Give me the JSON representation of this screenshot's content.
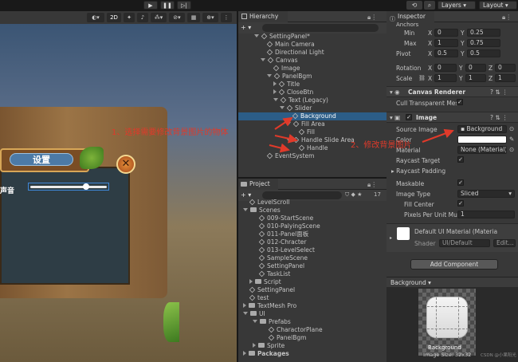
{
  "toolbar": {
    "play": "▶",
    "pause": "❚❚",
    "step": "▷|",
    "search": "⌕",
    "layers": "Layers",
    "layout": "Layout"
  },
  "scene": {
    "btn2d": "2D",
    "title_text": "设置",
    "sound_label": "声音",
    "close_symbol": "✕"
  },
  "hierarchy": {
    "tab": "Hierarchy",
    "add": "+ ▾",
    "items": [
      "SettingPanel*",
      "Main Camera",
      "Directional Light",
      "Canvas",
      "Image",
      "PanelBgm",
      "Title",
      "CloseBtn",
      "Text (Legacy)",
      "Slider",
      "Background",
      "Fill Area",
      "Fill",
      "Handle Slide Area",
      "Handle",
      "EventSystem"
    ]
  },
  "project": {
    "tab": "Project",
    "add": "+ ▾",
    "count": "17",
    "items": [
      "LevelScroll",
      "Scenes",
      "009-StartScene",
      "010-PalyingScene",
      "011-Panel面板",
      "012-Chracter",
      "013-LevelSelect",
      "SampleScene",
      "SettingPanel",
      "TaskList",
      "Script",
      "SettingPanel",
      "test",
      "TextMesh Pro",
      "UI",
      "Prefabs",
      "CharactorPlane",
      "PanelBgm",
      "Sprite",
      "Packages"
    ]
  },
  "annotations": {
    "step1": "1、选择需要修改背景图片的物体",
    "step2": "2、修改背景图片"
  },
  "inspector": {
    "tab": "Inspector",
    "anchors": "Anchors",
    "min_label": "Min",
    "max_label": "Max",
    "pivot_label": "Pivot",
    "rotation_label": "Rotation",
    "scale_label": "Scale",
    "min_x": "0",
    "min_y": "0.25",
    "max_x": "1",
    "max_y": "0.75",
    "pivot_x": "0.5",
    "pivot_y": "0.5",
    "rot_x": "0",
    "rot_y": "0",
    "rot_z": "0",
    "scale_x": "1",
    "scale_y": "1",
    "scale_z": "1",
    "canvas_renderer": "Canvas Renderer",
    "cull": "Cull Transparent Mes",
    "image": "Image",
    "source_image_label": "Source Image",
    "source_image": "Background",
    "color_label": "Color",
    "material_label": "Material",
    "material": "None (Material)",
    "raycast_target": "Raycast Target",
    "raycast_padding": "Raycast Padding",
    "maskable": "Maskable",
    "image_type_label": "Image Type",
    "image_type": "Sliced",
    "fill_center": "Fill Center",
    "ppu_label": "Pixels Per Unit Mul",
    "ppu": "1",
    "default_mat": "Default UI Material (Materia",
    "shader_label": "Shader",
    "shader": "UI/Default",
    "edit": "Edit...",
    "add_component": "Add Component",
    "preview_title": "Background ▾",
    "preview_name": "Background",
    "preview_size": "Image Size: 32x32",
    "watermark": "CSDN @小果阳光"
  },
  "colors": {
    "accent": "#2c5d87",
    "annotation": "#e03a2a"
  }
}
